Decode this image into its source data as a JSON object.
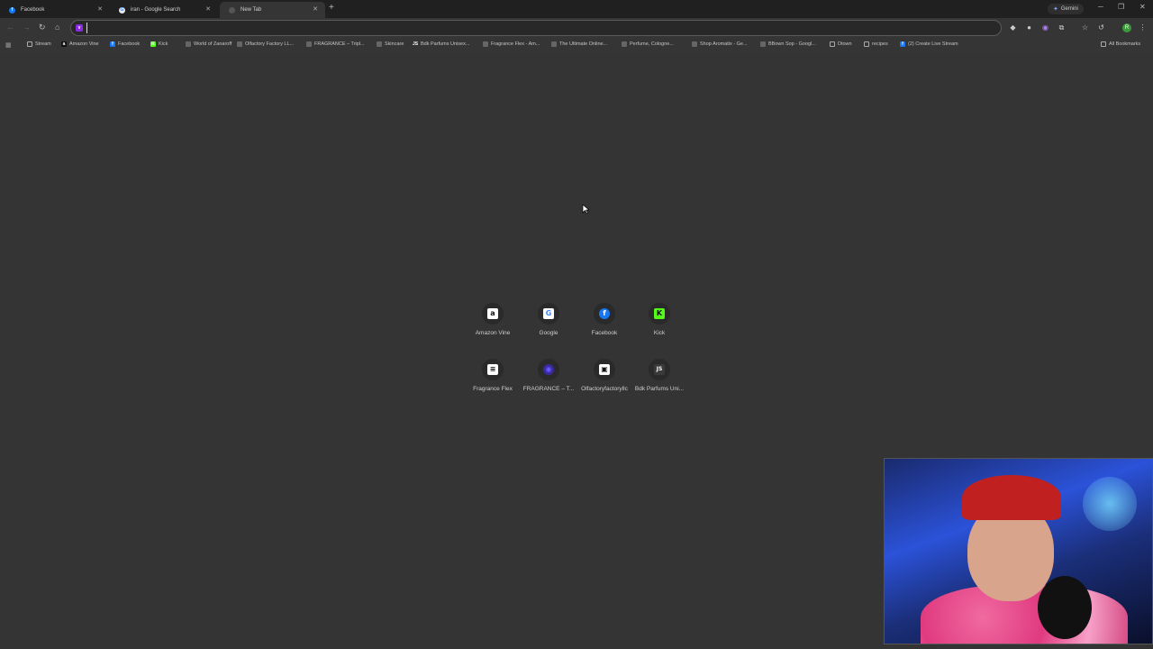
{
  "tabs": [
    {
      "label": "Facebook",
      "icon": "facebook-icon",
      "active": false
    },
    {
      "label": "iran - Google Search",
      "icon": "google-icon",
      "active": false
    },
    {
      "label": "New Tab",
      "icon": "chrome-icon",
      "active": true
    }
  ],
  "gemini": {
    "label": "Gemini"
  },
  "omnibox": {
    "value": "",
    "placeholder": ""
  },
  "bookmarks": [
    {
      "label": "Stream",
      "icon": "folder-icon"
    },
    {
      "label": "Amazon Vine",
      "icon": "amazon-icon"
    },
    {
      "label": "Facebook",
      "icon": "facebook-icon"
    },
    {
      "label": "Kick",
      "icon": "kick-icon"
    },
    {
      "label": "World of Zanaroff",
      "icon": "page-icon"
    },
    {
      "label": "Olfactory Factory LL...",
      "icon": "page-icon"
    },
    {
      "label": "FRAGRANCE – Tripl...",
      "icon": "page-icon"
    },
    {
      "label": "Skincare",
      "icon": "page-icon"
    },
    {
      "label": "Bdk Parfums Unisex...",
      "icon": "js-icon"
    },
    {
      "label": "Fragrance Flex - Am...",
      "icon": "page-icon"
    },
    {
      "label": "The Ultimate Online...",
      "icon": "page-icon"
    },
    {
      "label": "Perfume, Cologne...",
      "icon": "page-icon"
    },
    {
      "label": "Shop Aromatix - Ge...",
      "icon": "page-icon"
    },
    {
      "label": "BBown Sop - Googl...",
      "icon": "page-icon"
    },
    {
      "label": "Dtown",
      "icon": "folder-icon"
    },
    {
      "label": "recipes",
      "icon": "folder-icon"
    },
    {
      "label": "(2) Create Live Stream",
      "icon": "facebook-icon"
    }
  ],
  "all_bookmarks": {
    "label": "All Bookmarks"
  },
  "shortcuts": [
    {
      "label": "Amazon Vine",
      "glyph": "a",
      "icon": "amazon-icon"
    },
    {
      "label": "Google",
      "glyph": "G",
      "icon": "google-icon"
    },
    {
      "label": "Facebook",
      "glyph": "f",
      "icon": "facebook-icon"
    },
    {
      "label": "Kick",
      "glyph": "K",
      "icon": "kick-icon"
    },
    {
      "label": "Fragrance Flex",
      "glyph": "≡",
      "icon": "fragrance-flex-icon"
    },
    {
      "label": "FRAGRANCE – T...",
      "glyph": "◉",
      "icon": "fragrance-icon"
    },
    {
      "label": "Olfactoryfactoryllc",
      "glyph": "▣",
      "icon": "shop-icon"
    },
    {
      "label": "Bdk Parfums Uni...",
      "glyph": "JS",
      "icon": "js-icon"
    }
  ],
  "colors": {
    "background": "#343434",
    "tabstrip": "#202020",
    "facebook": "#1877f2",
    "kick": "#53fc18",
    "omnibox_icon": "#8a2be2"
  }
}
